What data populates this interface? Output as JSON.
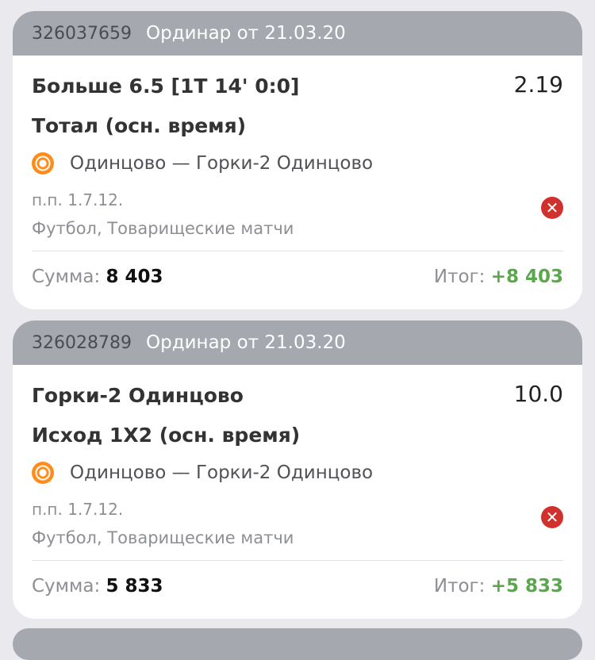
{
  "bets": [
    {
      "id": "326037659",
      "type_label": "Ординар от 21.03.20",
      "selection": "Больше 6.5 [1Т 14' 0:0]",
      "odds": "2.19",
      "market": "Тотал (осн. время)",
      "event": "Одинцово — Горки-2 Одинцово",
      "meta_code": "п.п. 1.7.12.",
      "meta_sport": "Футбол, Товарищеские матчи",
      "sum_label": "Сумма:",
      "sum_value": "8 403",
      "result_label": "Итог:",
      "result_value": "+8 403"
    },
    {
      "id": "326028789",
      "type_label": "Ординар от 21.03.20",
      "selection": "Горки-2 Одинцово",
      "odds": "10.0",
      "market": "Исход 1X2 (осн. время)",
      "event": "Одинцово — Горки-2 Одинцово",
      "meta_code": "п.п. 1.7.12.",
      "meta_sport": "Футбол, Товарищеские матчи",
      "sum_label": "Сумма:",
      "sum_value": "5 833",
      "result_label": "Итог:",
      "result_value": "+5 833"
    }
  ],
  "colors": {
    "header_bg": "#a5a8ae",
    "result_positive": "#5ba84c",
    "lost_badge": "#d0312d",
    "ball_orange": "#ff8c1a"
  },
  "icons": {
    "sport": "football-icon",
    "status": "close-icon"
  }
}
